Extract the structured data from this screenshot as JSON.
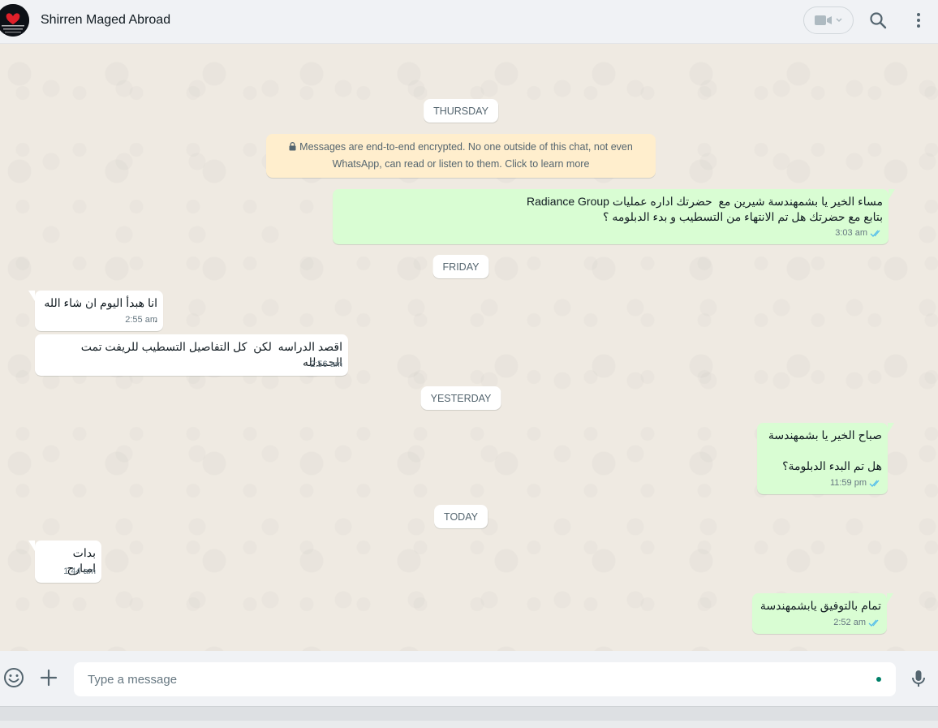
{
  "header": {
    "contact_name": "Shirren Maged Abroad"
  },
  "encryption_notice": {
    "line1": "Messages are end-to-end encrypted. No one outside of this chat, not even",
    "line2": "WhatsApp, can read or listen to them. Click to learn more"
  },
  "dates": {
    "thursday": "THURSDAY",
    "friday": "FRIDAY",
    "yesterday": "YESTERDAY",
    "today": "TODAY"
  },
  "messages": [
    {
      "direction": "out",
      "text": "مساء الخير يا بشمهندسة شيرين مع  حضرتك اداره عمليات Radiance Group\nبتابع مع حضرتك هل تم الانتهاء من التسطيب و بدء الدبلومه ؟",
      "time": "3:03 am",
      "status": "read"
    },
    {
      "direction": "in",
      "text": "انا هبدأ اليوم ان شاء الله .",
      "time": "2:55 am"
    },
    {
      "direction": "in",
      "text": "اقصد الدراسه  لكن  كل التفاصيل التسطيب للريفت تمت الحمدلله",
      "time": "2:56 am"
    },
    {
      "direction": "out",
      "text": "صباح الخير يا بشمهندسة\n\nهل تم البدء الدبلومة؟",
      "time": "11:59 pm",
      "status": "read"
    },
    {
      "direction": "in",
      "text": "بدات امبارح",
      "time": "1:44 am"
    },
    {
      "direction": "out",
      "text": "تمام بالتوفيق يابشمهندسة",
      "time": "2:52 am",
      "status": "read"
    }
  ],
  "composer": {
    "placeholder": "Type a message"
  },
  "colors": {
    "outgoing_bubble": "#d9fdd3",
    "incoming_bubble": "#ffffff",
    "chat_background": "#efeae2",
    "read_ticks": "#53bdeb",
    "encryption_bg": "#ffeecd"
  },
  "icons": [
    "avatar-image",
    "video-call-icon",
    "chevron-down-icon",
    "search-icon",
    "menu-icon",
    "lock-icon",
    "double-check-icon",
    "emoji-icon",
    "plus-icon",
    "mic-icon"
  ]
}
